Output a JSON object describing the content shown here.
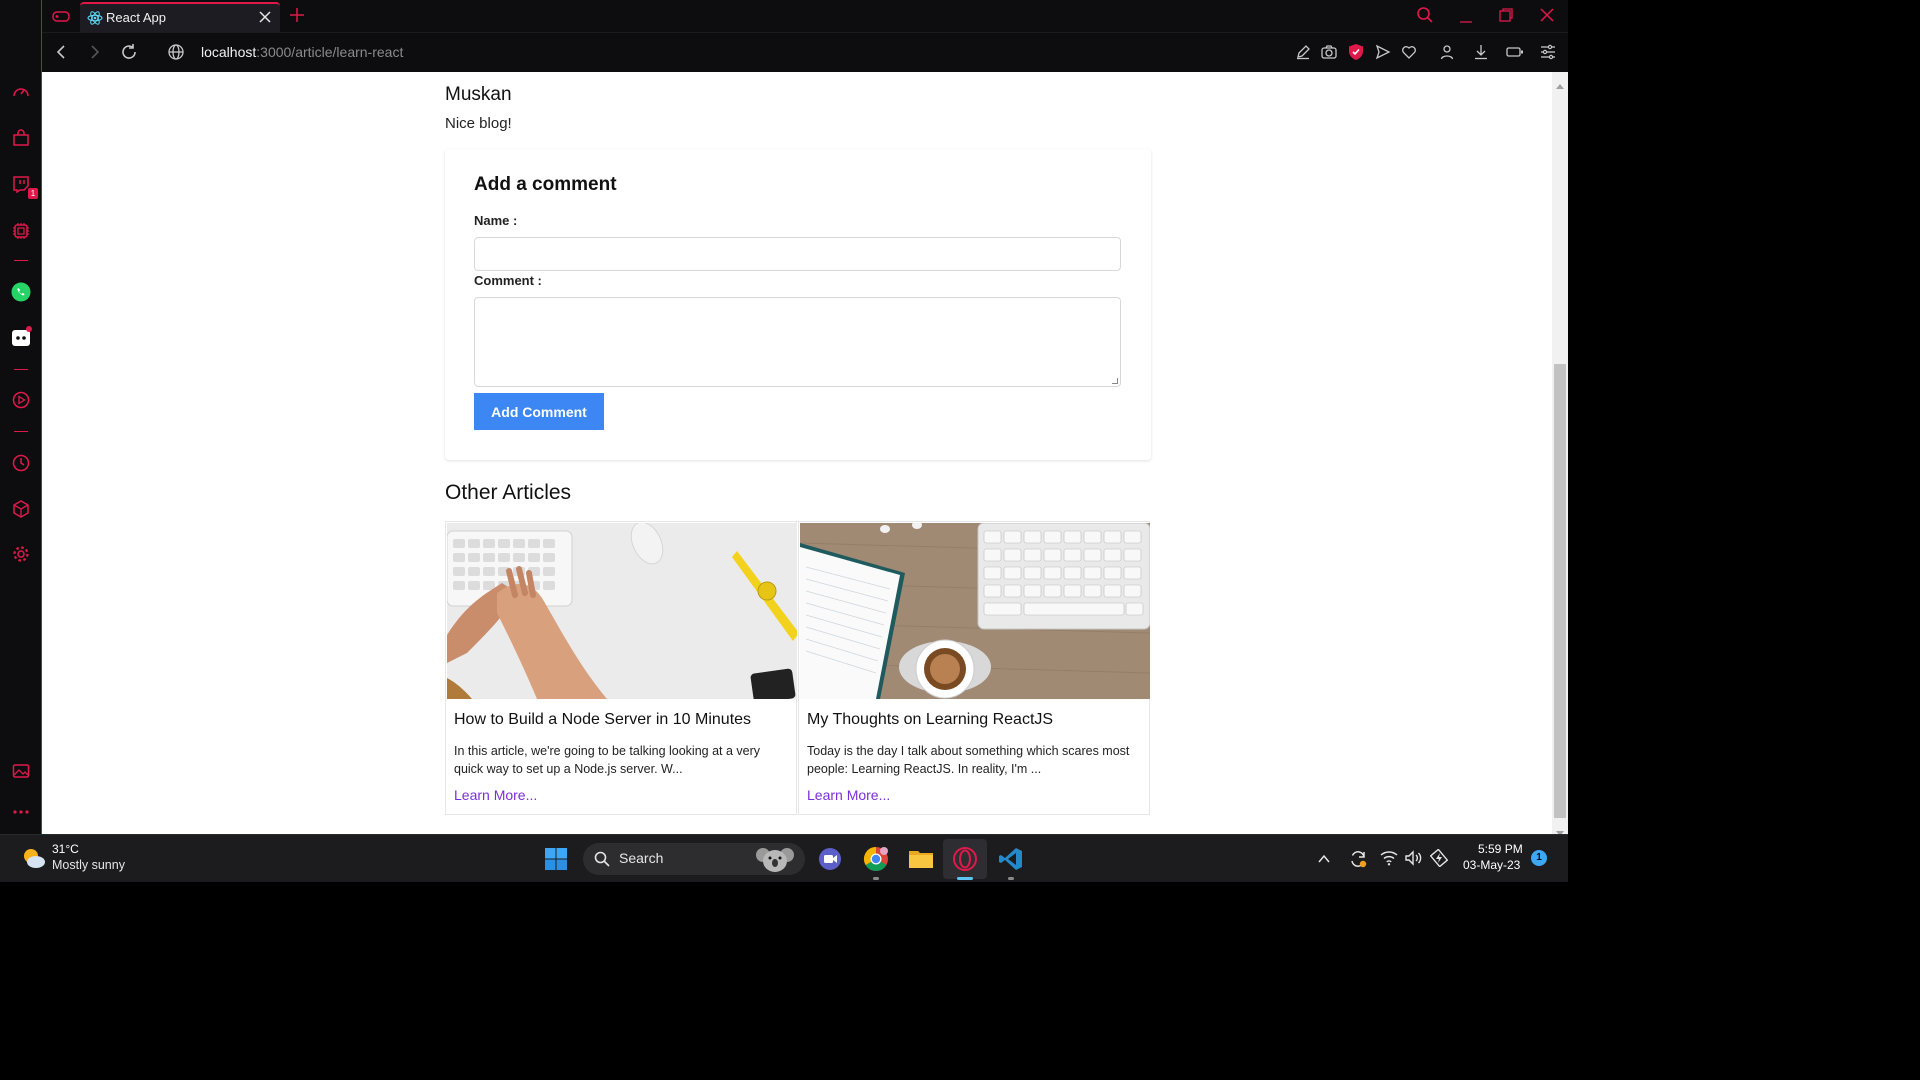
{
  "browser": {
    "tab_title": "React App",
    "url_host": "localhost",
    "url_path": ":3000/article/learn-react",
    "sidebar_badge": "1"
  },
  "page": {
    "comment": {
      "author": "Muskan",
      "text": "Nice blog!"
    },
    "form": {
      "title": "Add a comment",
      "name_label": "Name :",
      "comment_label": "Comment :",
      "name_value": "",
      "comment_value": "",
      "button_label": "Add Comment"
    },
    "other_articles_title": "Other Articles",
    "articles": [
      {
        "title": "How to Build a Node Server in 10 Minutes",
        "excerpt": "In this article, we're going to be talking looking at a very quick way to set up a Node.js server. W...",
        "link": "Learn More..."
      },
      {
        "title": "My Thoughts on Learning ReactJS",
        "excerpt": "Today is the day I talk about something which scares most people: Learning ReactJS. In reality, I'm ...",
        "link": "Learn More..."
      }
    ]
  },
  "taskbar": {
    "weather_temp": "31°C",
    "weather_desc": "Mostly sunny",
    "search_label": "Search",
    "time": "5:59 PM",
    "date": "03-May-23",
    "notification_count": "1"
  },
  "colors": {
    "accent": "#e0194a",
    "button": "#3d87f5",
    "link": "#7a2fd6"
  }
}
